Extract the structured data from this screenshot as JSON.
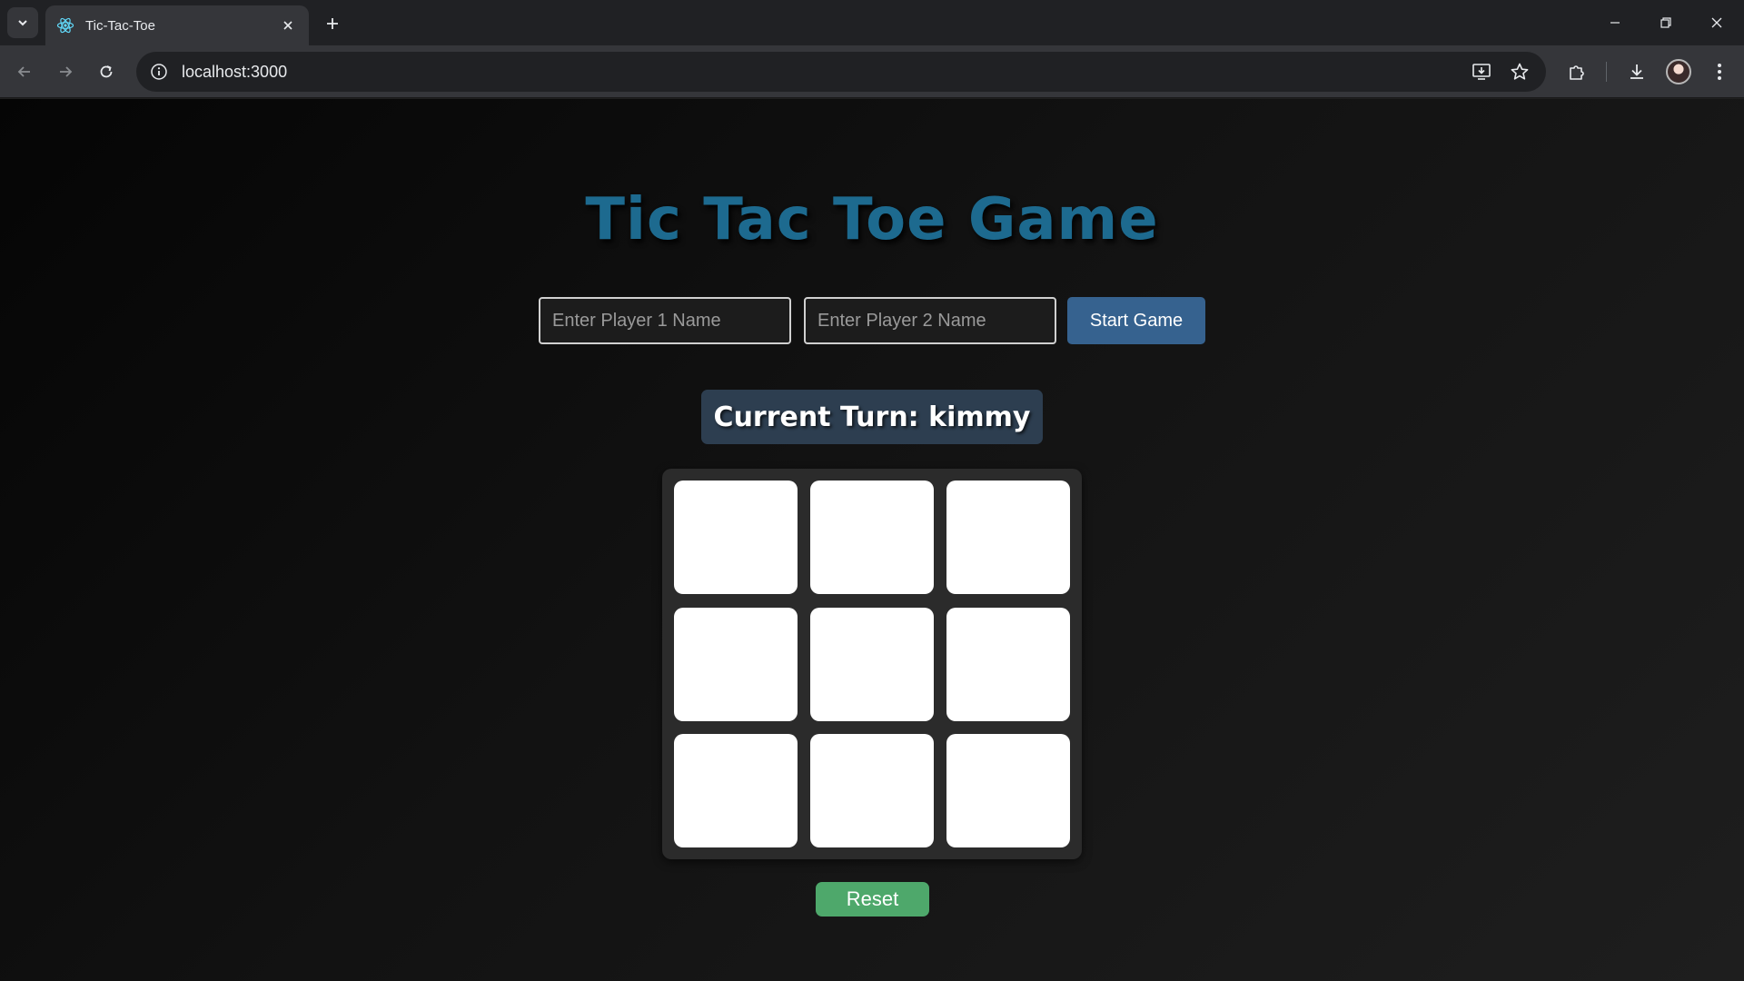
{
  "browser": {
    "tab_title": "Tic-Tac-Toe",
    "url": "localhost:3000",
    "icons": {
      "tab_search": "chevron-down-icon",
      "favicon": "react-icon",
      "tab_close": "close-icon",
      "new_tab": "plus-icon",
      "minimize": "minimize-icon",
      "restore": "restore-icon",
      "close_window": "close-icon",
      "back": "back-arrow-icon",
      "forward": "forward-arrow-icon",
      "reload": "reload-icon",
      "site_info": "info-icon",
      "install": "install-app-icon",
      "bookmark": "star-icon",
      "extensions": "puzzle-icon",
      "downloads": "download-icon",
      "profile": "avatar",
      "menu": "kebab-menu-icon"
    }
  },
  "game": {
    "title": "Tic Tac Toe Game",
    "player1": {
      "placeholder": "Enter Player 1 Name",
      "value": ""
    },
    "player2": {
      "placeholder": "Enter Player 2 Name",
      "value": ""
    },
    "start_label": "Start Game",
    "turn_text": "Current Turn: kimmy",
    "board": [
      "",
      "",
      "",
      "",
      "",
      "",
      "",
      "",
      ""
    ],
    "reset_label": "Reset"
  },
  "colors": {
    "title": "#1d6a8f",
    "start_button": "#36628f",
    "turn_box": "#2d3e50",
    "reset_button": "#4ea86b",
    "board_bg": "#2b2b2b",
    "cell": "#ffffff"
  }
}
